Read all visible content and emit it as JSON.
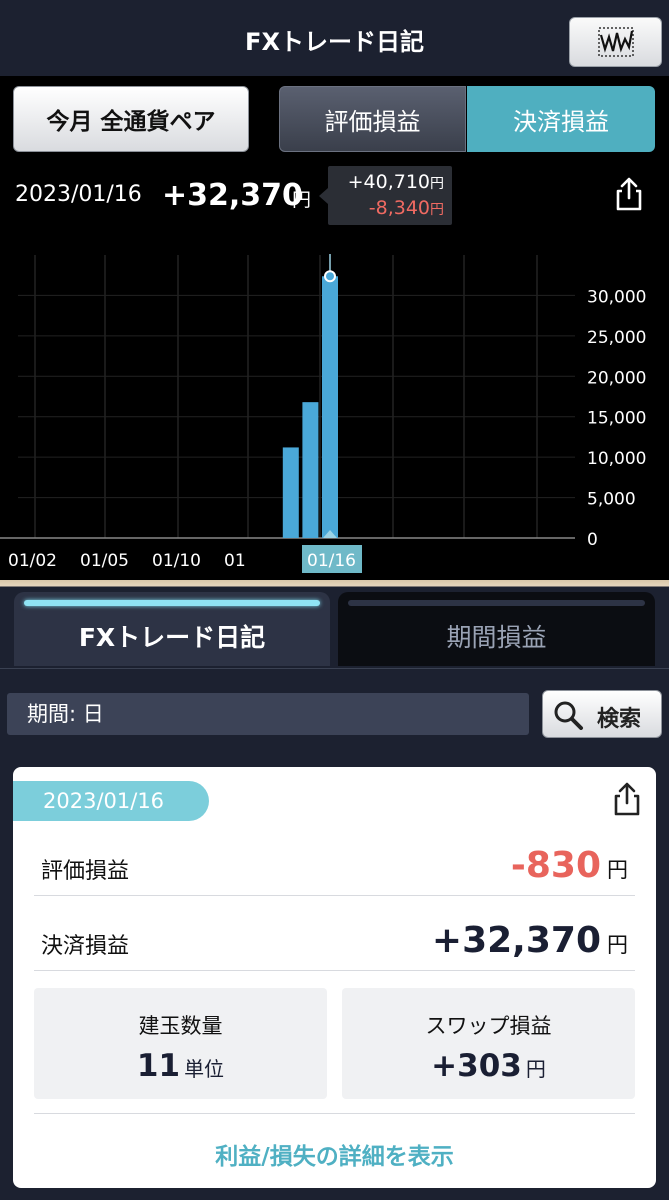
{
  "header": {
    "title": "FXトレード日記",
    "chart_mode_icon": "waveform-chart-icon"
  },
  "controls": {
    "period_label": "今月 全通貨ペア",
    "segments": [
      {
        "label": "評価損益",
        "selected": false
      },
      {
        "label": "決済損益",
        "selected": true
      }
    ]
  },
  "summary": {
    "date": "2023/01/16",
    "total": "+32,370",
    "total_unit": "円",
    "tooltip_positive": "+40,710",
    "tooltip_negative": "-8,340",
    "tooltip_unit": "円"
  },
  "chart_data": {
    "type": "bar",
    "x_tick_labels": [
      "01/02",
      "01/05",
      "01/10",
      "01"
    ],
    "highlight_label": "01/16",
    "y_ticks": [
      "0",
      "5,000",
      "10,000",
      "15,000",
      "20,000",
      "25,000",
      "30,000"
    ],
    "ylim": [
      0,
      35000
    ],
    "bars": [
      {
        "day": 14,
        "value": 11200
      },
      {
        "day": 15,
        "value": 16800
      },
      {
        "day": 16,
        "value": 32370
      }
    ],
    "selected_day": 16,
    "colors": {
      "bar": "#4aa8d8",
      "highlight": "#4aa8d8",
      "grid": "#333",
      "axis_text": "#fff"
    }
  },
  "tabs": [
    {
      "label": "FXトレード日記",
      "active": true
    },
    {
      "label": "期間損益",
      "active": false
    }
  ],
  "filter": {
    "period_text": "期間: 日",
    "search_label": "検索"
  },
  "card": {
    "date": "2023/01/16",
    "rows": [
      {
        "label": "評価損益",
        "value": "-830",
        "unit": "円"
      },
      {
        "label": "決済損益",
        "value": "+32,370",
        "unit": "円"
      }
    ],
    "stats": [
      {
        "label": "建玉数量",
        "value": "11",
        "unit": "単位"
      },
      {
        "label": "スワップ損益",
        "value": "+303",
        "unit": "円"
      }
    ],
    "detail_link": "利益/損失の詳細を表示"
  }
}
